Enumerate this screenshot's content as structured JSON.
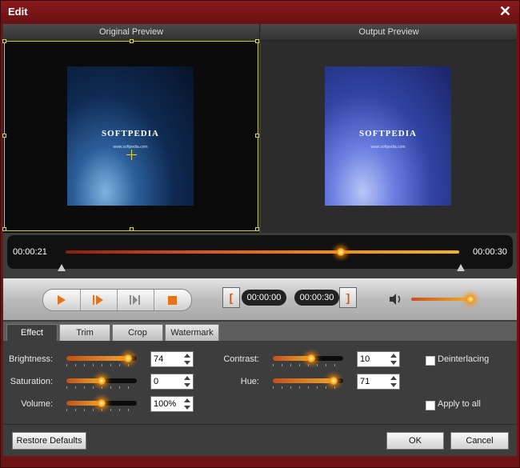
{
  "window": {
    "title": "Edit"
  },
  "preview": {
    "original_label": "Original Preview",
    "output_label": "Output Preview",
    "brand_text": "SOFTPEDIA",
    "brand_url": "www.softpedia.com"
  },
  "timeline": {
    "start_time": "00:00:21",
    "end_time": "00:00:30",
    "playhead_fraction": 0.7
  },
  "playback": {
    "icons": [
      "play-icon",
      "next-frame-icon",
      "last-frame-icon",
      "stop-icon"
    ]
  },
  "clip": {
    "start_bracket": "[",
    "start_time": "00:00:00",
    "end_time": "00:00:30",
    "end_bracket": "]",
    "volume_level": 1.0
  },
  "tabs": [
    {
      "label": "Effect",
      "active": true
    },
    {
      "label": "Trim"
    },
    {
      "label": "Crop"
    },
    {
      "label": "Watermark"
    }
  ],
  "effect": {
    "brightness": {
      "label": "Brightness:",
      "value": "74",
      "level": 0.87
    },
    "saturation": {
      "label": "Saturation:",
      "value": "0",
      "level": 0.5
    },
    "volume": {
      "label": "Volume:",
      "value": "100%",
      "level": 0.5
    },
    "contrast": {
      "label": "Contrast:",
      "value": "10",
      "level": 0.55
    },
    "hue": {
      "label": "Hue:",
      "value": "71",
      "level": 0.86
    },
    "deinterlacing_label": "Deinterlacing",
    "apply_all_label": "Apply to all"
  },
  "footer": {
    "restore_label": "Restore Defaults",
    "ok_label": "OK",
    "cancel_label": "Cancel"
  },
  "colors": {
    "frame": "#6e1416",
    "accent": "#f08a1c",
    "panel": "#3d3d3d"
  }
}
